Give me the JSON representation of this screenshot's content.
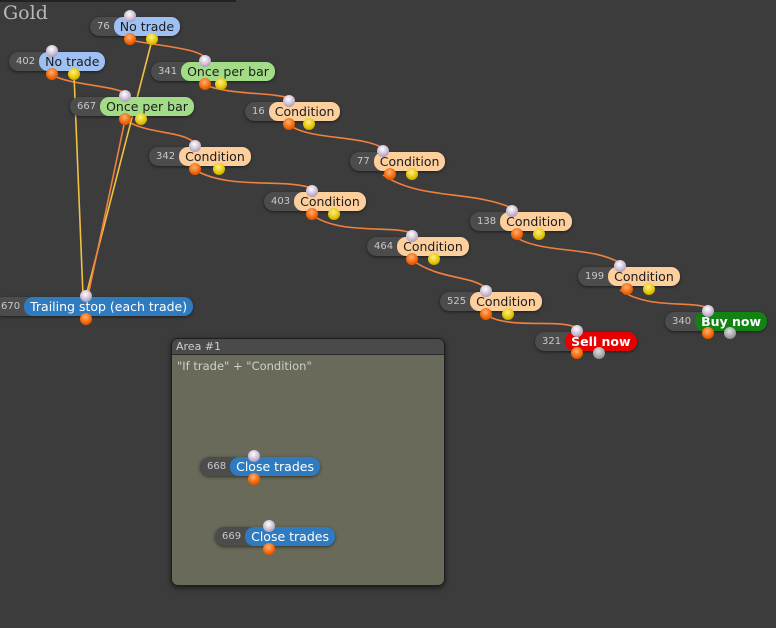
{
  "canvas": {
    "title": "Gold"
  },
  "area": {
    "title": "Area #1",
    "description": "\"If trade\" + \"Condition\""
  },
  "nodes": [
    {
      "id": "76",
      "label": "No trade"
    },
    {
      "id": "402",
      "label": "No trade"
    },
    {
      "id": "341",
      "label": "Once per bar"
    },
    {
      "id": "667",
      "label": "Once per bar"
    },
    {
      "id": "16",
      "label": "Condition"
    },
    {
      "id": "342",
      "label": "Condition"
    },
    {
      "id": "77",
      "label": "Condition"
    },
    {
      "id": "403",
      "label": "Condition"
    },
    {
      "id": "138",
      "label": "Condition"
    },
    {
      "id": "464",
      "label": "Condition"
    },
    {
      "id": "199",
      "label": "Condition"
    },
    {
      "id": "670",
      "label": "Trailing stop (each trade)"
    },
    {
      "id": "525",
      "label": "Condition"
    },
    {
      "id": "340",
      "label": "Buy now"
    },
    {
      "id": "321",
      "label": "Sell now"
    },
    {
      "id": "668",
      "label": "Close trades"
    },
    {
      "id": "669",
      "label": "Close trades"
    }
  ],
  "colors": {
    "background": "#3c3c3c",
    "no_trade": "#9fc0f2",
    "once_per_bar": "#a3dc86",
    "condition": "#fccf9c",
    "action_blue": "#2f7bbf",
    "sell": "#e70000",
    "buy": "#128212",
    "wire_main": "#f08040",
    "wire_yellow": "#f0c040",
    "area_fill": "#6a6a5a"
  },
  "icons": [
    "input-connector-icon",
    "output-connector-icon",
    "yes-output-icon",
    "no-output-icon"
  ]
}
